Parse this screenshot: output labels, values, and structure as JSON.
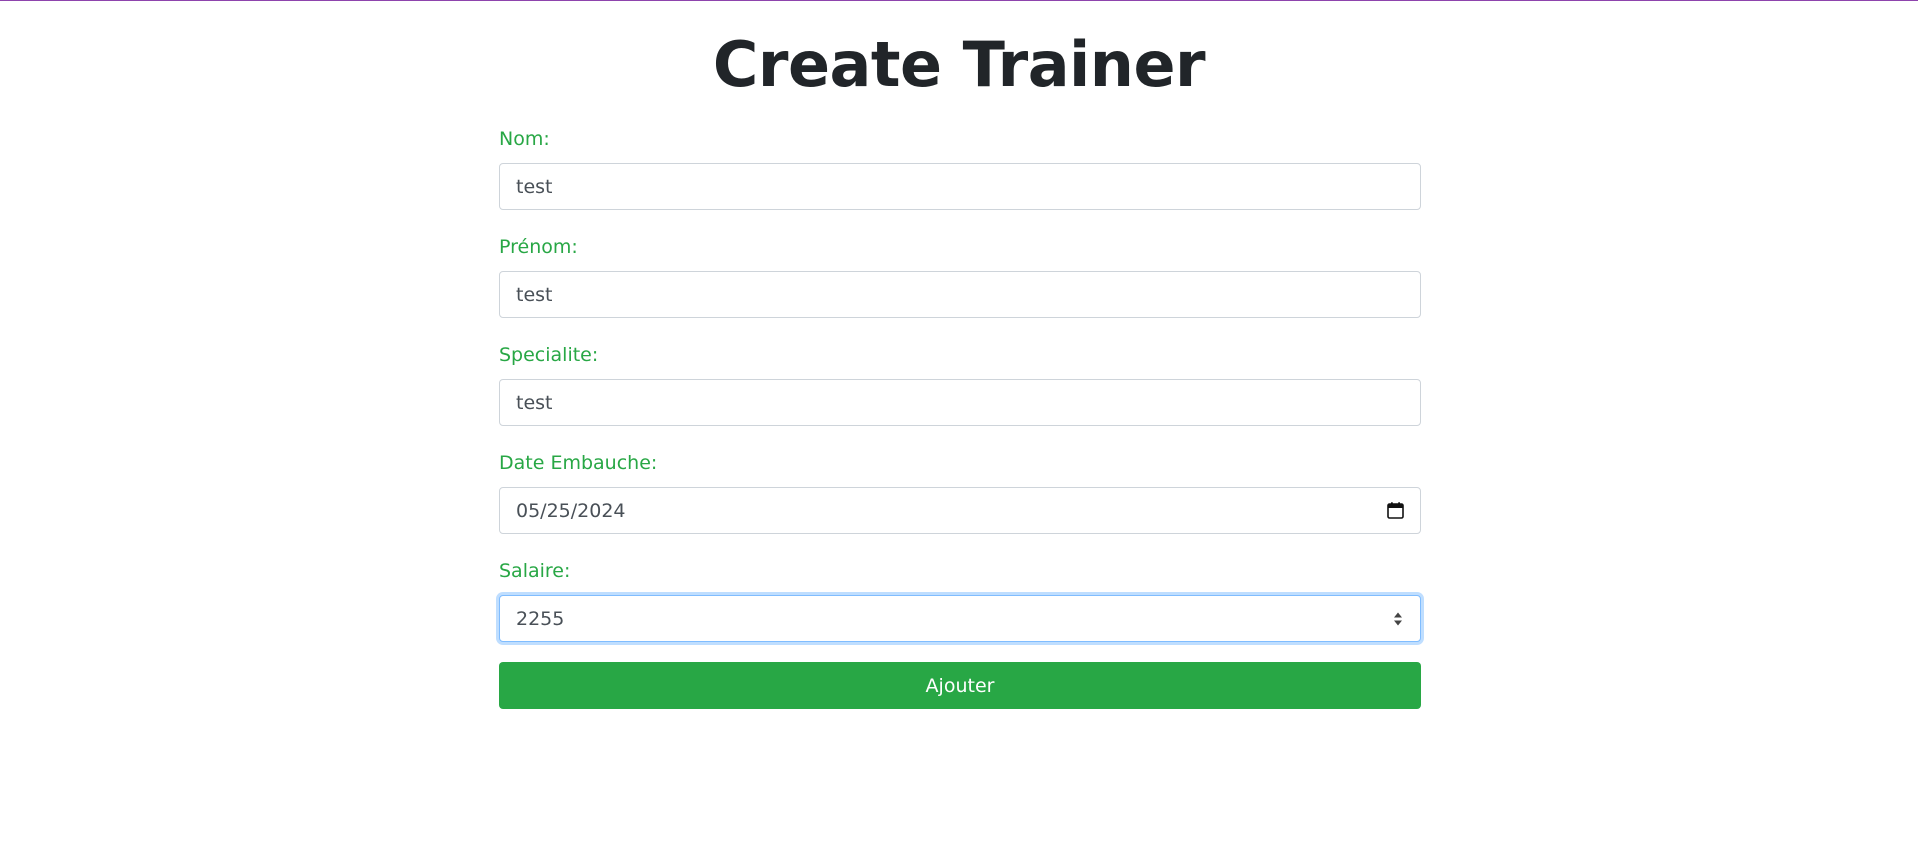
{
  "page": {
    "title": "Create Trainer"
  },
  "form": {
    "fields": [
      {
        "label": "Nom:",
        "value": "test",
        "type": "text"
      },
      {
        "label": "Prénom:",
        "value": "test",
        "type": "text"
      },
      {
        "label": "Specialite:",
        "value": "test",
        "type": "text"
      },
      {
        "label": "Date Embauche:",
        "value": "05/25/2024",
        "type": "date",
        "icon": "calendar-icon"
      },
      {
        "label": "Salaire:",
        "value": "2255",
        "type": "number",
        "icon": "spinner-icon",
        "focused": true
      }
    ],
    "submit_label": "Ajouter"
  },
  "colors": {
    "label": "#28a745",
    "button": "#28a745",
    "title": "#212529",
    "focus_border": "#80bdff",
    "top_border": "#8e44ad"
  }
}
